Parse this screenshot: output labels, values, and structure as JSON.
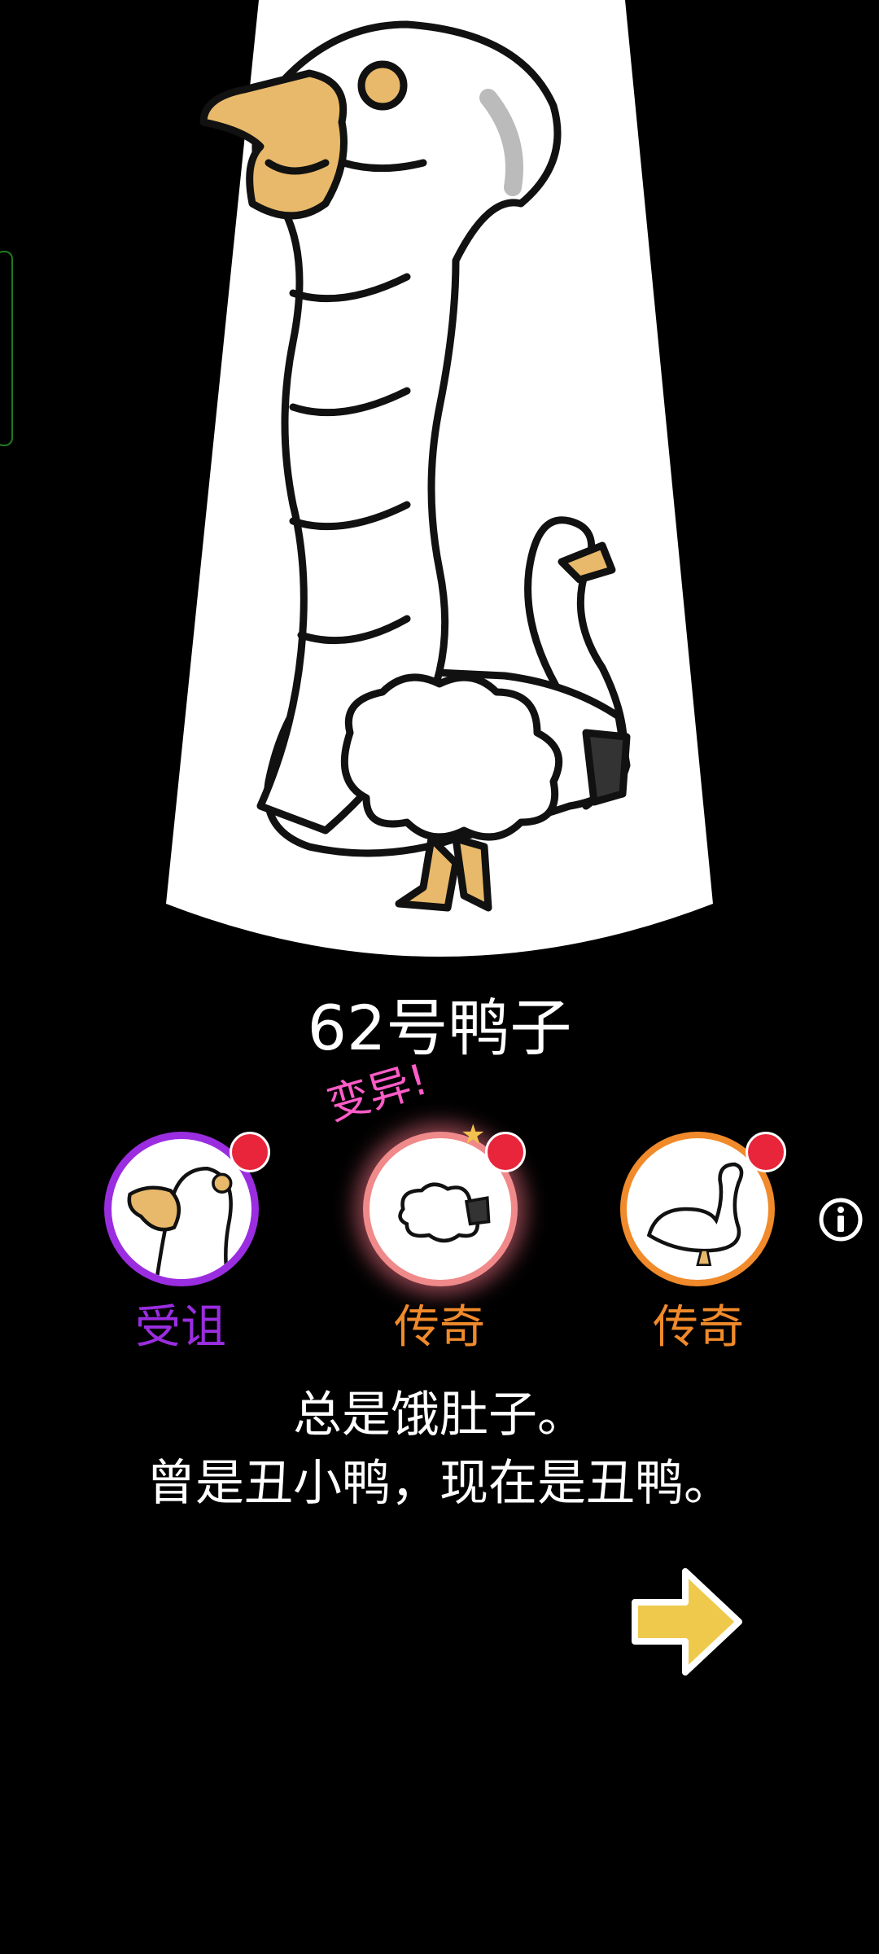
{
  "duck": {
    "name": "62号鸭子"
  },
  "mutation_label": "变异!",
  "parts": [
    {
      "rarity": "受诅",
      "color": "#9b2de0"
    },
    {
      "rarity": "传奇",
      "color": "#f08a2a"
    },
    {
      "rarity": "传奇",
      "color": "#f08a2a"
    }
  ],
  "description": {
    "line1": "总是饿肚子。",
    "line2": "曾是丑小鸭，现在是丑鸭。"
  },
  "icons": {
    "info": "info-icon",
    "next": "arrow-right-icon"
  }
}
